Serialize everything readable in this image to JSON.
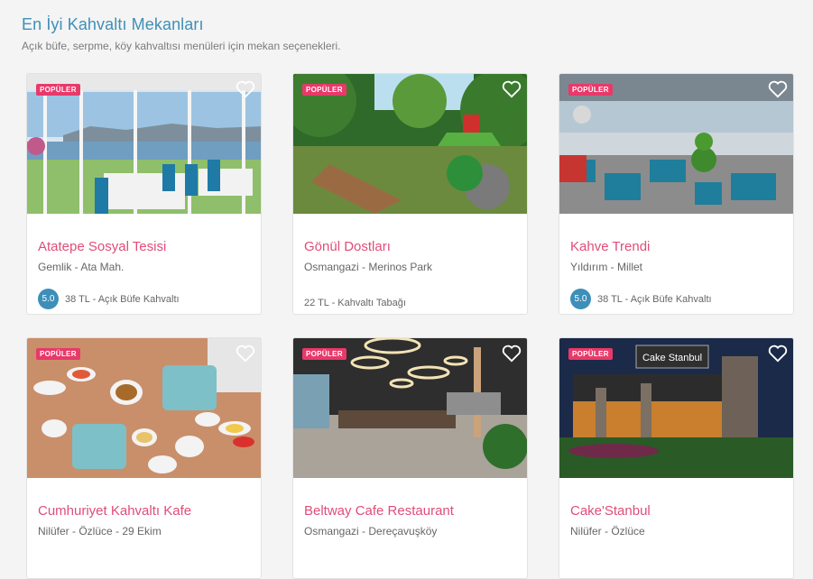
{
  "header": {
    "title": "En İyi Kahvaltı Mekanları",
    "subtitle": "Açık büfe, serpme, köy kahvaltısı menüleri için mekan seçenekleri."
  },
  "colors": {
    "accent_blue": "#3d8fb9",
    "brand_pink": "#e04d79",
    "badge": "#e8396a"
  },
  "cards": [
    {
      "name": "Atatepe Sosyal Tesisi",
      "location": "Gemlik - Ata Mah.",
      "badge": "POPÜLER",
      "rating": "5.0",
      "price": "38 TL - Açık Büfe Kahvaltı",
      "image": "restaurant-sea-view-photo"
    },
    {
      "name": "Gönül Dostları",
      "location": "Osmangazi - Merinos Park",
      "badge": "POPÜLER",
      "rating": null,
      "price": "22 TL - Kahvaltı Tabağı",
      "image": "garden-playground-photo"
    },
    {
      "name": "Kahve Trendi",
      "location": "Yıldırım - Millet",
      "badge": "POPÜLER",
      "rating": "5.0",
      "price": "38 TL - Açık Büfe Kahvaltı",
      "image": "cafe-terrace-photo"
    },
    {
      "name": "Cumhuriyet Kahvaltı Kafe",
      "location": "Nilüfer - Özlüce - 29 Ekim",
      "badge": "POPÜLER",
      "rating": null,
      "price": "",
      "image": "breakfast-spread-photo"
    },
    {
      "name": "Beltway Cafe Restaurant",
      "location": "Osmangazi - Dereçavuşköy",
      "badge": "POPÜLER",
      "rating": null,
      "price": "",
      "image": "modern-interior-photo"
    },
    {
      "name": "Cake'Stanbul",
      "location": "Nilüfer - Özlüce",
      "badge": "POPÜLER",
      "rating": null,
      "price": "",
      "image": "night-facade-photo",
      "sign_text": "Cake Stanbul"
    }
  ]
}
